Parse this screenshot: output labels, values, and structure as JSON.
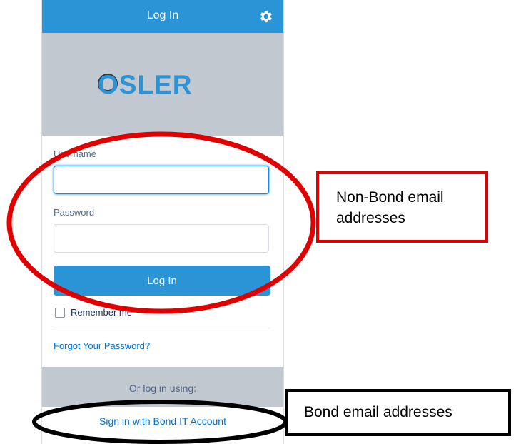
{
  "header": {
    "title": "Log In",
    "settings_icon": "gear-icon"
  },
  "hero": {
    "logo_text": "OSLER",
    "logo_color": "#2a94d6"
  },
  "form": {
    "username_label": "Username",
    "username_value": "",
    "password_label": "Password",
    "password_value": "",
    "login_button": "Log In",
    "remember_label": "Remember me",
    "remember_checked": false,
    "forgot_link": "Forgot Your Password?"
  },
  "alternate": {
    "prompt": "Or log in using:",
    "sso_link": "Sign in with Bond IT Account"
  },
  "annotations": {
    "non_bond": "Non-Bond email addresses",
    "bond": "Bond email addresses",
    "red_color": "#e00000",
    "black_color": "#000000"
  },
  "colors": {
    "accent": "#2a94d6",
    "link": "#0070d2",
    "band": "#c2c8cf"
  }
}
